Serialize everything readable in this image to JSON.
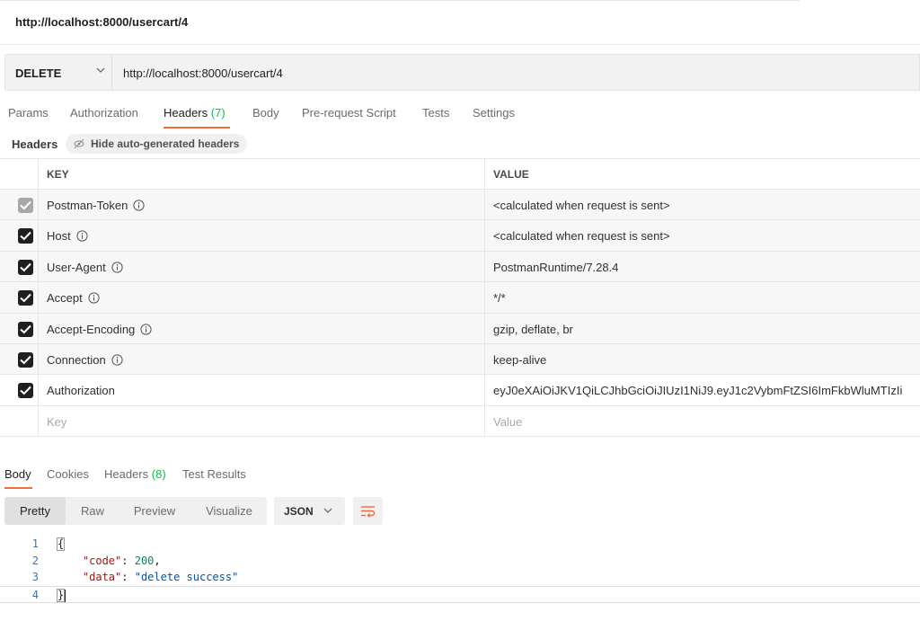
{
  "window": {
    "title": "http://localhost:8000/usercart/4"
  },
  "request": {
    "method": "DELETE",
    "url": "http://localhost:8000/usercart/4"
  },
  "request_tabs": [
    {
      "label": "Params"
    },
    {
      "label": "Authorization"
    },
    {
      "label": "Headers",
      "count": "(7)"
    },
    {
      "label": "Body"
    },
    {
      "label": "Pre-request Script"
    },
    {
      "label": "Tests"
    },
    {
      "label": "Settings"
    }
  ],
  "headers_section": {
    "label": "Headers",
    "hide_button": "Hide auto-generated headers"
  },
  "headers_table": {
    "columns": {
      "key": "KEY",
      "value": "VALUE"
    },
    "rows": [
      {
        "key": "Postman-Token",
        "value": "<calculated when request is sent>",
        "checked": true,
        "disabled": true,
        "info": true
      },
      {
        "key": "Host",
        "value": "<calculated when request is sent>",
        "checked": true,
        "info": true
      },
      {
        "key": "User-Agent",
        "value": "PostmanRuntime/7.28.4",
        "checked": true,
        "info": true
      },
      {
        "key": "Accept",
        "value": "*/*",
        "checked": true,
        "info": true
      },
      {
        "key": "Accept-Encoding",
        "value": "gzip, deflate, br",
        "checked": true,
        "info": true
      },
      {
        "key": "Connection",
        "value": "keep-alive",
        "checked": true,
        "info": true
      },
      {
        "key": "Authorization",
        "value": "eyJ0eXAiOiJKV1QiLCJhbGciOiJIUzI1NiJ9.eyJ1c2VybmFtZSI6ImFkbWluMTIzIi",
        "checked": true,
        "info": false
      }
    ],
    "new_row": {
      "key_placeholder": "Key",
      "value_placeholder": "Value"
    }
  },
  "response_tabs": [
    {
      "label": "Body"
    },
    {
      "label": "Cookies"
    },
    {
      "label": "Headers",
      "count": "(8)"
    },
    {
      "label": "Test Results"
    }
  ],
  "view_modes": [
    "Pretty",
    "Raw",
    "Preview",
    "Visualize"
  ],
  "format": "JSON",
  "response_body": {
    "line_numbers": [
      "1",
      "2",
      "3",
      "4"
    ],
    "open_brace": "{",
    "close_brace": "}",
    "code_key": "\"code\"",
    "code_value": "200",
    "data_key": "\"data\"",
    "data_value": "\"delete success\""
  },
  "colors": {
    "accent": "#f26b3a",
    "count": "#0cbb52"
  }
}
